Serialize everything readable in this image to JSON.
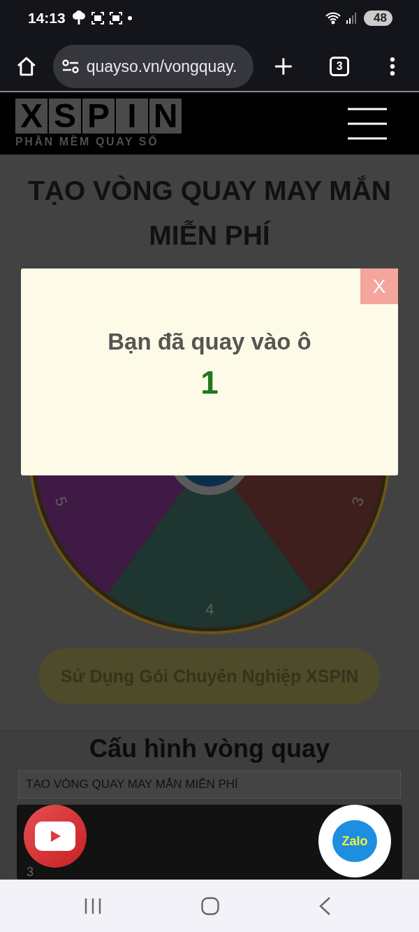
{
  "status_bar": {
    "time": "14:13",
    "battery": "48"
  },
  "browser": {
    "url": "quayso.vn/vongquay.",
    "tab_count": "3"
  },
  "site_header": {
    "logo": [
      "X",
      "S",
      "P",
      "I",
      "N"
    ],
    "tagline": "PHẦN MỀM QUAY SỐ"
  },
  "page_title": "TẠO VÒNG QUAY MAY MẮN MIỄN PHÍ",
  "wheel": {
    "segments": [
      {
        "label": "3",
        "color": "#3f1e1e"
      },
      {
        "label": "4",
        "color": "#1e3530"
      },
      {
        "label": "5",
        "color": "#3f1a45"
      }
    ]
  },
  "pro_button": "Sử Dụng Gói Chuyên Nghiệp XSPIN",
  "config": {
    "title": "Cấu hình vòng quay",
    "name_value": "TẠO VÒNG QUAY MAY MẮN MIỄN PHÍ",
    "entries": [
      "3"
    ]
  },
  "result_dialog": {
    "close": "X",
    "message": "Bạn đã quay vào ô",
    "result": "1"
  },
  "zalo_button": "Zalo"
}
